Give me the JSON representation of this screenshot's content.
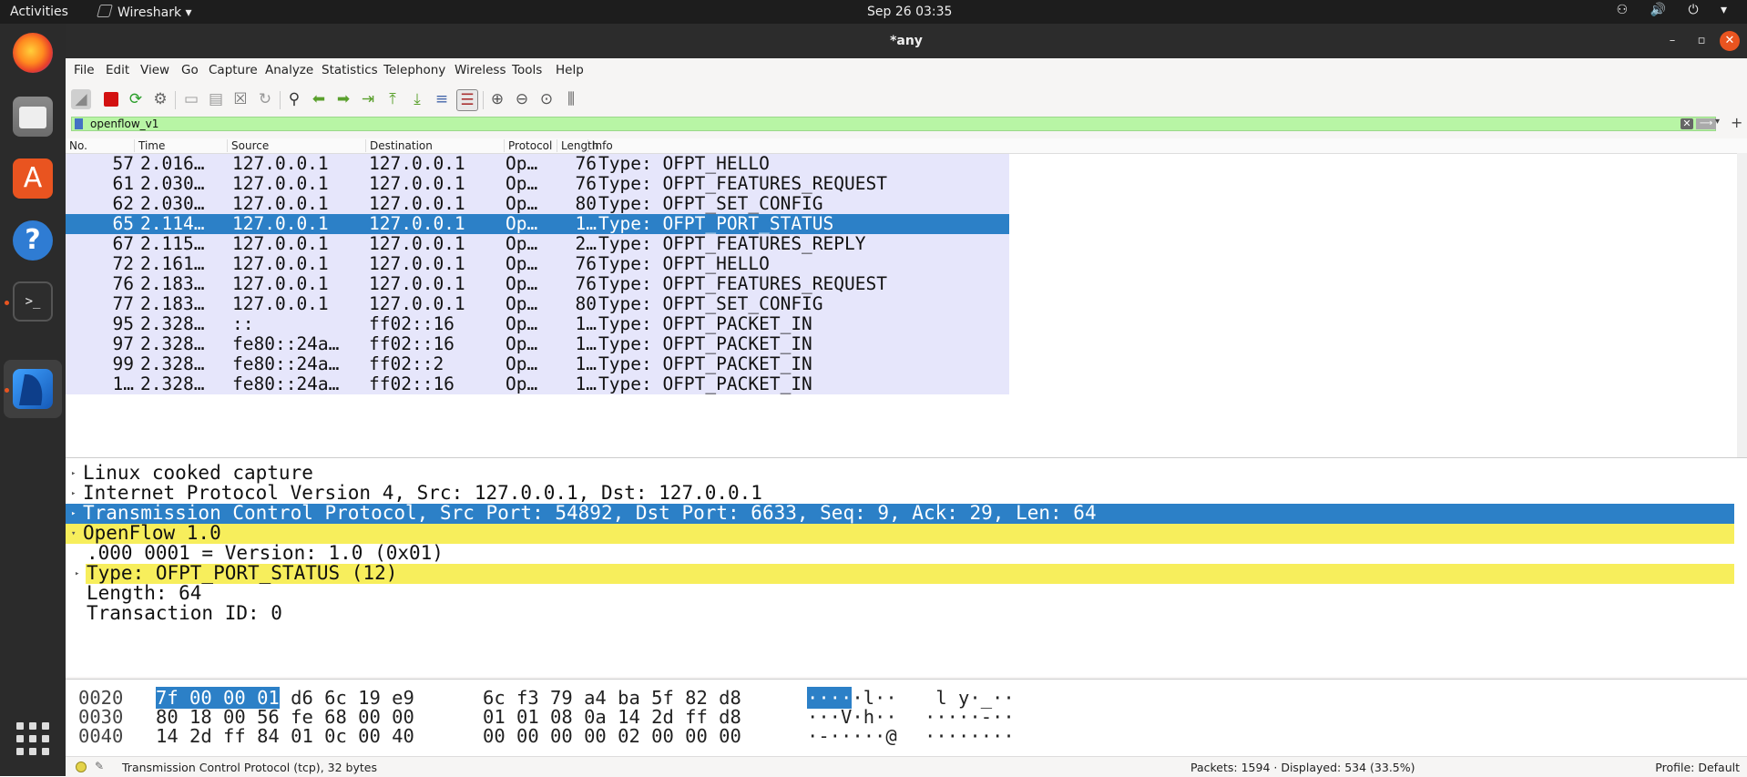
{
  "topbar": {
    "activities": "Activities",
    "app_menu": "Wireshark ▾",
    "clock": "Sep 26  03:35",
    "tray": "⚇ 🔊 ⏻ ▾"
  },
  "window": {
    "title": "*any",
    "minimize": "–",
    "maximize": "▫",
    "close": "✕"
  },
  "menu": [
    "File",
    "Edit",
    "View",
    "Go",
    "Capture",
    "Analyze",
    "Statistics",
    "Telephony",
    "Wireless",
    "Tools",
    "Help"
  ],
  "filter": {
    "value": "openflow_v1",
    "clear": "✕",
    "apply": "⟶",
    "dropdown": "▾",
    "add": "+"
  },
  "packet_list": {
    "columns": [
      "No.",
      "Time",
      "Source",
      "Destination",
      "Protocol",
      "Length",
      "Info"
    ],
    "rows": [
      {
        "no": "57",
        "time": "2.016…",
        "src": "127.0.0.1",
        "dst": "127.0.0.1",
        "proto": "Op…",
        "len": "76",
        "info": "Type: OFPT_HELLO"
      },
      {
        "no": "61",
        "time": "2.030…",
        "src": "127.0.0.1",
        "dst": "127.0.0.1",
        "proto": "Op…",
        "len": "76",
        "info": "Type: OFPT_FEATURES_REQUEST"
      },
      {
        "no": "62",
        "time": "2.030…",
        "src": "127.0.0.1",
        "dst": "127.0.0.1",
        "proto": "Op…",
        "len": "80",
        "info": "Type: OFPT_SET_CONFIG"
      },
      {
        "no": "65",
        "time": "2.114…",
        "src": "127.0.0.1",
        "dst": "127.0.0.1",
        "proto": "Op…",
        "len": "1…",
        "info": "Type: OFPT_PORT_STATUS"
      },
      {
        "no": "67",
        "time": "2.115…",
        "src": "127.0.0.1",
        "dst": "127.0.0.1",
        "proto": "Op…",
        "len": "2…",
        "info": "Type: OFPT_FEATURES_REPLY"
      },
      {
        "no": "72",
        "time": "2.161…",
        "src": "127.0.0.1",
        "dst": "127.0.0.1",
        "proto": "Op…",
        "len": "76",
        "info": "Type: OFPT_HELLO"
      },
      {
        "no": "76",
        "time": "2.183…",
        "src": "127.0.0.1",
        "dst": "127.0.0.1",
        "proto": "Op…",
        "len": "76",
        "info": "Type: OFPT_FEATURES_REQUEST"
      },
      {
        "no": "77",
        "time": "2.183…",
        "src": "127.0.0.1",
        "dst": "127.0.0.1",
        "proto": "Op…",
        "len": "80",
        "info": "Type: OFPT_SET_CONFIG"
      },
      {
        "no": "95",
        "time": "2.328…",
        "src": "::",
        "dst": "ff02::16",
        "proto": "Op…",
        "len": "1…",
        "info": "Type: OFPT_PACKET_IN"
      },
      {
        "no": "97",
        "time": "2.328…",
        "src": "fe80::24a…",
        "dst": "ff02::16",
        "proto": "Op…",
        "len": "1…",
        "info": "Type: OFPT_PACKET_IN"
      },
      {
        "no": "99",
        "time": "2.328…",
        "src": "fe80::24a…",
        "dst": "ff02::2",
        "proto": "Op…",
        "len": "1…",
        "info": "Type: OFPT_PACKET_IN"
      },
      {
        "no": "1…",
        "time": "2.328…",
        "src": "fe80::24a…",
        "dst": "ff02::16",
        "proto": "Op…",
        "len": "1…",
        "info": "Type: OFPT_PACKET_IN"
      }
    ],
    "selected_index": 3
  },
  "details": [
    {
      "text": "Linux cooked capture",
      "expander": "▸",
      "style": "normal"
    },
    {
      "text": "Internet Protocol Version 4, Src: 127.0.0.1, Dst: 127.0.0.1",
      "expander": "▸",
      "style": "normal"
    },
    {
      "text": "Transmission Control Protocol, Src Port: 54892, Dst Port: 6633, Seq: 9, Ack: 29, Len: 64",
      "expander": "▸",
      "style": "selected"
    },
    {
      "text": "OpenFlow 1.0",
      "expander": "▾",
      "style": "highlight"
    },
    {
      "text": ".000 0001 = Version: 1.0 (0x01)",
      "expander": "",
      "style": "normal"
    },
    {
      "text": "Type: OFPT_PORT_STATUS (12)",
      "expander": "▸",
      "style": "highlight"
    },
    {
      "text": "Length: 64",
      "expander": "",
      "style": "normal"
    },
    {
      "text": "Transaction ID: 0",
      "expander": "",
      "style": "normal"
    }
  ],
  "bytes": [
    {
      "offset": "0020",
      "hex_sel": "7f 00 00 01",
      "hex_rest": " d6 6c 19 e9",
      "hex2": "6c f3 79 a4 ba 5f 82 d8",
      "ascii_sel": "····",
      "ascii_rest": "·l··",
      "ascii2": " l y·_··"
    },
    {
      "offset": "0030",
      "hex_sel": "",
      "hex_rest": "80 18 00 56 fe 68 00 00",
      "hex2": "01 01 08 0a 14 2d ff d8",
      "ascii_sel": "",
      "ascii_rest": "···V·h··",
      "ascii2": "·····-··"
    },
    {
      "offset": "0040",
      "hex_sel": "",
      "hex_rest": "14 2d ff 84 01 0c 00 40",
      "hex2": "00 00 00 00 02 00 00 00",
      "ascii_sel": "",
      "ascii_rest": "·-·····@",
      "ascii2": "········"
    }
  ],
  "status": {
    "text": "Transmission Control Protocol (tcp), 32 bytes",
    "packets": "Packets: 1594 · Displayed: 534 (33.5%)",
    "profile": "Profile: Default"
  },
  "colors": {
    "selection": "#2c80c7",
    "row_bg": "#e6e6fb",
    "highlight": "#f7ee5c",
    "filter_ok": "#b8f5a5"
  }
}
